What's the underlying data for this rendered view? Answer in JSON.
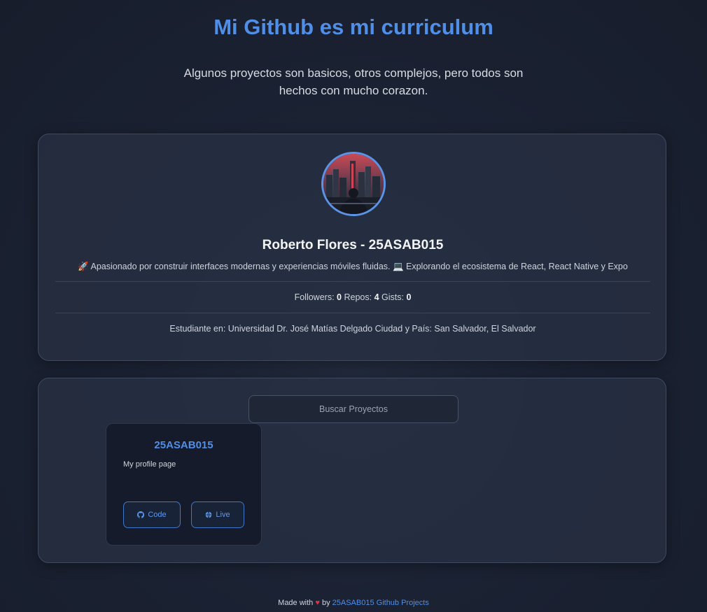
{
  "header": {
    "title": "Mi Github es mi curriculum",
    "subtitle": "Algunos proyectos son basicos, otros complejos, pero todos son hechos con mucho corazon."
  },
  "profile": {
    "avatar_icon": "user-avatar-city-night",
    "name": "Roberto Flores - 25ASAB015",
    "bio": "🚀 Apasionado por construir interfaces modernas y experiencias móviles fluidas. 💻 Explorando el ecosistema de React, React Native y Expo",
    "stats": {
      "followers_label": "Followers:",
      "followers": "0",
      "repos_label": "Repos:",
      "repos": "4",
      "gists_label": "Gists:",
      "gists": "0"
    },
    "education": "Estudiante en: Universidad Dr. José Matías Delgado Ciudad y País: San Salvador, El Salvador"
  },
  "projects": {
    "search_placeholder": "Buscar Proyectos",
    "items": [
      {
        "title": "25ASAB015",
        "description": "My profile page",
        "code_label": "Code",
        "code_icon": "github-icon",
        "live_label": "Live",
        "live_icon": "globe-icon"
      }
    ]
  },
  "footer": {
    "made_with": "Made with",
    "heart": "♥",
    "by": "by",
    "link_text": "25ASAB015 Github Projects"
  },
  "colors": {
    "accent": "#4f8fe8",
    "background": "#1b2233",
    "heart": "#e0314b"
  }
}
